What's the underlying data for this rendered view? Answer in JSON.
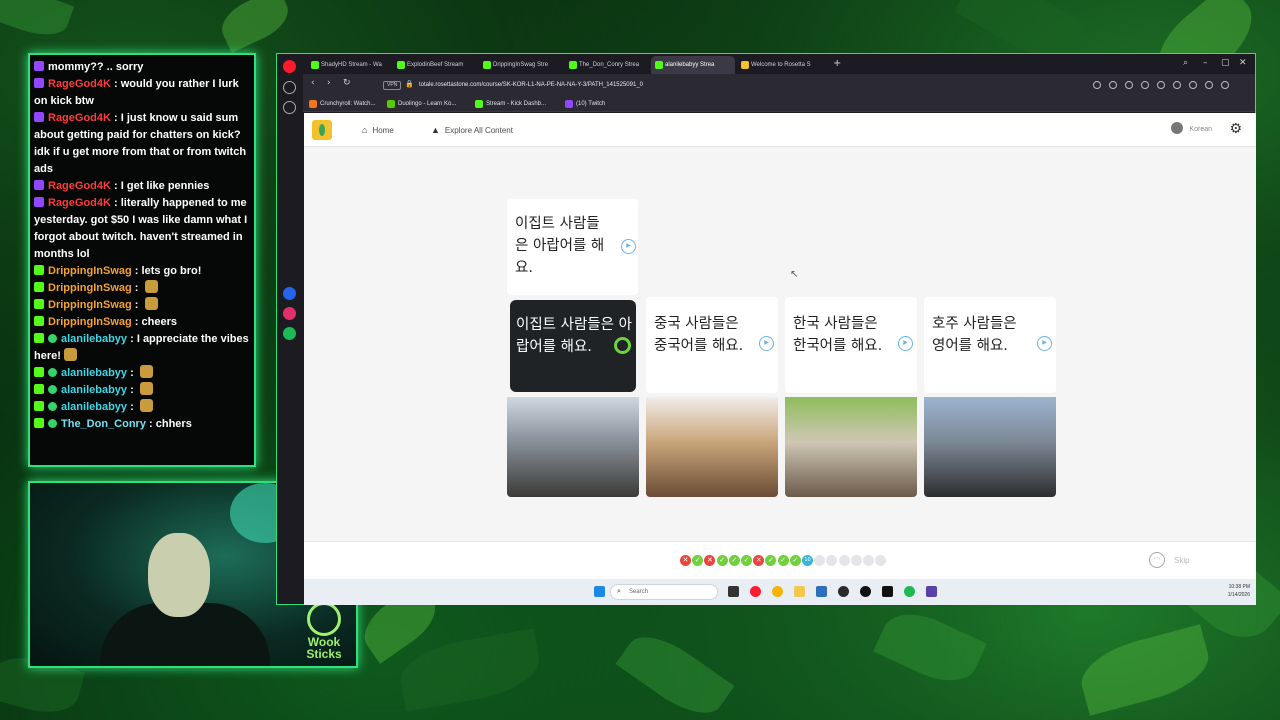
{
  "chat": {
    "messages": [
      {
        "user": "",
        "text": "mommy?? .. sorry",
        "badge": "twitch"
      },
      {
        "user": "RageGod4K",
        "text": "would you rather I lurk on kick btw",
        "badge": "twitch",
        "color": "#ff3b3b"
      },
      {
        "user": "RageGod4K",
        "text": "I just know u said sum about getting paid for chatters on kick? idk if u get more from that or from twitch ads",
        "badge": "twitch",
        "color": "#ff3b3b"
      },
      {
        "user": "RageGod4K",
        "text": "I get like pennies",
        "badge": "twitch",
        "color": "#ff3b3b"
      },
      {
        "user": "RageGod4K",
        "text": "literally happened to me yesterday. got $50 I was like damn what I forgot about twitch. haven't streamed in months lol",
        "badge": "twitch",
        "color": "#ff3b3b"
      },
      {
        "user": "DrippingInSwag",
        "text": "lets go bro!",
        "badge": "kick",
        "color": "#f4a233"
      },
      {
        "user": "DrippingInSwag",
        "text": "",
        "badge": "kick",
        "color": "#f4a233",
        "emote": true
      },
      {
        "user": "DrippingInSwag",
        "text": "",
        "badge": "kick",
        "color": "#f4a233",
        "emote": true
      },
      {
        "user": "DrippingInSwag",
        "text": "cheers",
        "badge": "kick",
        "color": "#f4a233"
      },
      {
        "user": "alanilebabyy",
        "text": "I appreciate the vibes here!",
        "badge": "kick",
        "mod": true,
        "color": "#3fd6e6",
        "emote": true
      },
      {
        "user": "alanilebabyy",
        "text": "",
        "badge": "kick",
        "mod": true,
        "color": "#3fd6e6",
        "emote": true
      },
      {
        "user": "alanilebabyy",
        "text": "",
        "badge": "kick",
        "mod": true,
        "color": "#3fd6e6",
        "emote": true
      },
      {
        "user": "alanilebabyy",
        "text": "",
        "badge": "kick",
        "mod": true,
        "color": "#3fd6e6",
        "emote": true
      },
      {
        "user": "The_Don_Conry",
        "text": "chhers",
        "badge": "kick",
        "mod": true,
        "color": "#6fe3f0"
      }
    ]
  },
  "cam": {
    "logo_line1": "Wook",
    "logo_line2": "Sticks"
  },
  "browser": {
    "tabs": [
      {
        "label": "ShadyHD Stream - Wa",
        "icon": "kick"
      },
      {
        "label": "ExplodinBeef Stream",
        "icon": "kick"
      },
      {
        "label": "DrippingInSwag Stre",
        "icon": "kick"
      },
      {
        "label": "The_Don_Conry Strea",
        "icon": "kick"
      },
      {
        "label": "alanilebabyy Strea",
        "icon": "kick",
        "active": true
      },
      {
        "label": "Welcome to Rosetta S",
        "icon": "rosetta"
      }
    ],
    "new_tab_label": "+",
    "url": "totale.rosettastone.com/course/SK-KOR-L1-NA-PE-NA-NA-Y-3/PATH_141525091_0",
    "vpn_label": "VPN",
    "bookmarks": [
      {
        "label": "Crunchyroll: Watch...",
        "color": "#f47521"
      },
      {
        "label": "Duolingo - Learn Ko...",
        "color": "#58cc02"
      },
      {
        "label": "Stream - Kick Dashb...",
        "color": "#53fc18"
      },
      {
        "label": "(10) Twitch",
        "color": "#9146ff"
      }
    ]
  },
  "site": {
    "nav_home": "Home",
    "nav_explore": "Explore All Content",
    "language": "Korean",
    "prompt_text": "이집트 사람들은 아랍어를 해요.",
    "choices": [
      {
        "text": "이집트 사람들은 아랍어를 해요.",
        "selected": true
      },
      {
        "text": "중국 사람들은 중국어를 해요.",
        "selected": false
      },
      {
        "text": "한국 사람들은 한국어를 해요.",
        "selected": false
      },
      {
        "text": "호주 사람들은 영어를 해요.",
        "selected": false
      }
    ],
    "progress": {
      "results": [
        "wrong",
        "correct",
        "wrong",
        "correct",
        "correct",
        "correct",
        "wrong",
        "correct",
        "correct",
        "correct",
        "current",
        "empty",
        "empty",
        "empty",
        "empty",
        "empty",
        "empty"
      ],
      "current_number": "10"
    },
    "skip_label": "Skip"
  },
  "taskbar": {
    "search_placeholder": "Search",
    "time": "10:38 PM",
    "date": "1/14/2026"
  },
  "colors": {
    "accent_green": "#2fe07d",
    "correct": "#6fd13b",
    "wrong": "#e8453c",
    "current": "#3bb4d8"
  }
}
